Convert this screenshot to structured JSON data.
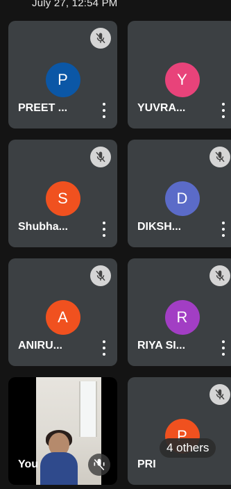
{
  "status": {
    "timestamp": "July 27, 12:54 PM"
  },
  "participants": [
    {
      "name": "PREET ...",
      "initial": "P",
      "avatar_color": "#0b57a6",
      "muted": true
    },
    {
      "name": "YUVRA...",
      "initial": "Y",
      "avatar_color": "#e8437a",
      "muted": false
    },
    {
      "name": "Shubha...",
      "initial": "S",
      "avatar_color": "#f0511f",
      "muted": true
    },
    {
      "name": "DIKSH...",
      "initial": "D",
      "avatar_color": "#5b6bc8",
      "muted": true
    },
    {
      "name": "ANIRU...",
      "initial": "A",
      "avatar_color": "#f0511f",
      "muted": true
    },
    {
      "name": "RIYA SI...",
      "initial": "R",
      "avatar_color": "#a23ec4",
      "muted": true
    },
    {
      "name": "PRI",
      "initial": "P",
      "avatar_color": "#f0511f",
      "muted": true
    }
  ],
  "self": {
    "label": "You"
  },
  "overflow": {
    "label": "4 others"
  },
  "icons": {
    "muted": "mic-off-icon",
    "more": "more-vert-icon",
    "audio_level": "audio-level-icon"
  }
}
